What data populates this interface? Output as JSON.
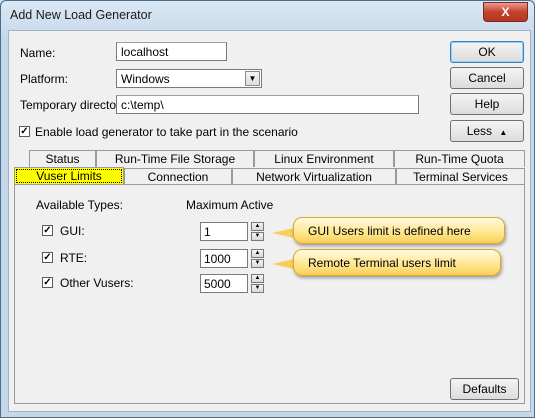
{
  "window": {
    "title": "Add New Load Generator",
    "close_label": "X"
  },
  "form": {
    "name_label": "Name:",
    "name_value": "localhost",
    "platform_label": "Platform:",
    "platform_value": "Windows",
    "tempdir_label": "Temporary directory:",
    "tempdir_value": "c:\\temp\\",
    "enable_checked": true,
    "enable_label": "Enable load generator to take part in the scenario"
  },
  "buttons": {
    "ok": "OK",
    "cancel": "Cancel",
    "help": "Help",
    "less": "Less",
    "defaults": "Defaults"
  },
  "tabs_row1": [
    "Status",
    "Run-Time File Storage",
    "Linux Environment",
    "Run-Time Quota"
  ],
  "tabs_row2": [
    "Vuser Limits",
    "Connection",
    "Network Virtualization",
    "Terminal Services"
  ],
  "vuser_limits": {
    "available_types_label": "Available Types:",
    "max_active_label": "Maximum Active",
    "rows": [
      {
        "label": "GUI:",
        "checked": true,
        "value": "1"
      },
      {
        "label": "RTE:",
        "checked": true,
        "value": "1000"
      },
      {
        "label": "Other Vusers:",
        "checked": true,
        "value": "5000"
      }
    ]
  },
  "callouts": {
    "gui": "GUI Users limit is defined here",
    "rte": "Remote Terminal users limit"
  },
  "colors": {
    "active_tab": "#ffff00",
    "callout": "#ffe58a",
    "close_button": "#c3412b"
  }
}
